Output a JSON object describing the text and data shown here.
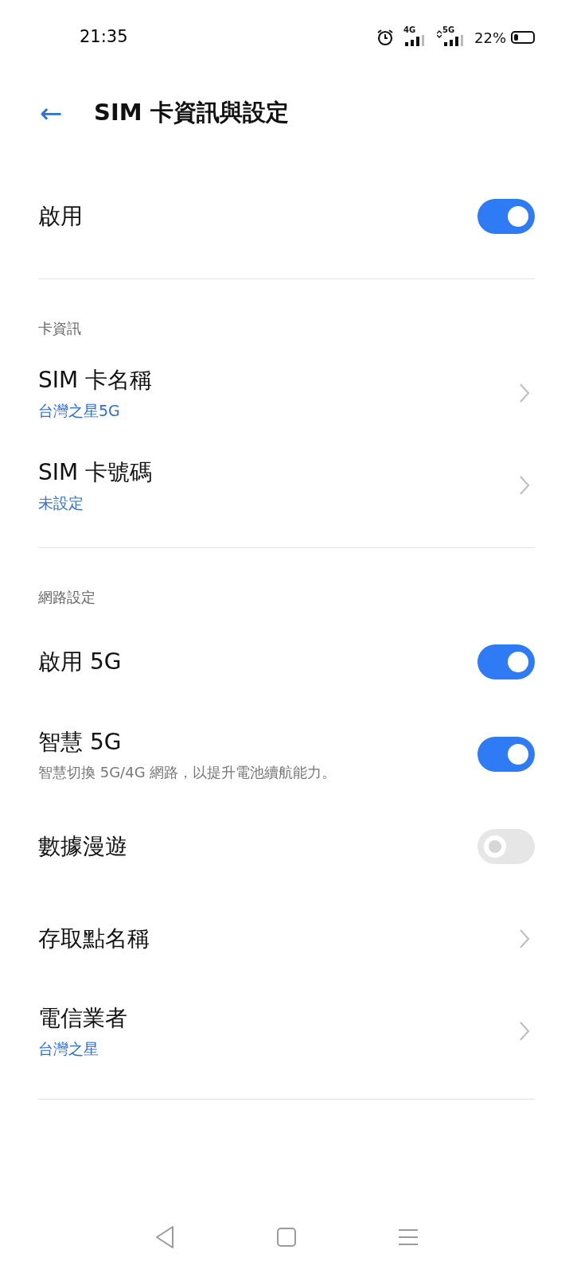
{
  "status_bar": {
    "time": "21:35",
    "network_1": "4G",
    "network_2": "5G",
    "battery": "22%"
  },
  "header": {
    "back": "←",
    "title": "SIM 卡資訊與設定"
  },
  "sections": [
    {
      "items": [
        {
          "kind": "toggle",
          "label": "啟用",
          "on": true
        }
      ]
    },
    {
      "heading": "卡資訊",
      "items": [
        {
          "kind": "link",
          "label": "SIM 卡名稱",
          "value": "台灣之星5G"
        },
        {
          "kind": "link",
          "label": "SIM 卡號碼",
          "value": "未設定"
        }
      ]
    },
    {
      "heading": "網路設定",
      "items": [
        {
          "kind": "toggle",
          "label": "啟用 5G",
          "on": true
        },
        {
          "kind": "toggle",
          "label": "智慧 5G",
          "description": "智慧切換 5G/4G 網路，以提升電池續航能力。",
          "on": true
        },
        {
          "kind": "toggle",
          "label": "數據漫遊",
          "on": false
        },
        {
          "kind": "link",
          "label": "存取點名稱"
        },
        {
          "kind": "link",
          "label": "電信業者",
          "value": "台灣之星"
        }
      ]
    }
  ]
}
